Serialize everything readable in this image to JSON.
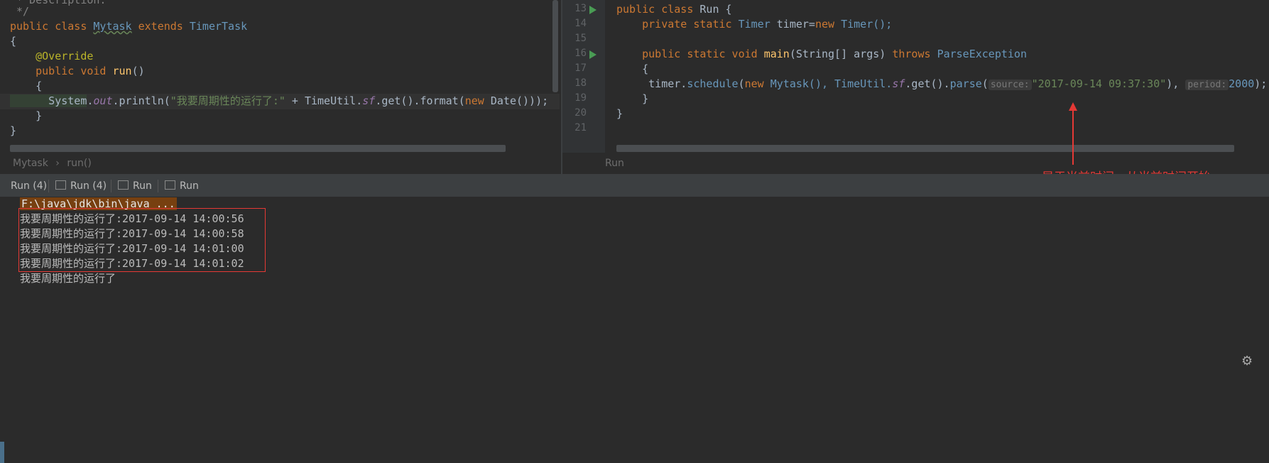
{
  "left_editor": {
    "lines": {
      "l0": " * Description:",
      "l1": " */",
      "l2_kw": "public class ",
      "l2_name": "Mytask",
      "l2_ext": " extends ",
      "l2_parent": "TimerTask",
      "l3": "{",
      "l4": "    @Override",
      "l5_kw": "    public void ",
      "l5_fn": "run",
      "l5_rest": "()",
      "l6": "    {",
      "l7_a": "      System",
      "l7_b": ".",
      "l7_out": "out",
      "l7_c": ".println(",
      "l7_str": "\"我要周期性的运行了:\"",
      "l7_d": " + TimeUtil.",
      "l7_sf": "sf",
      "l7_e": ".get().format(",
      "l7_new": "new ",
      "l7_f": "Date()));",
      "l8": "    }",
      "l9": "}"
    },
    "breadcrumb": {
      "class": "Mytask",
      "sep": "›",
      "method": "run()"
    }
  },
  "right_editor": {
    "line_numbers": [
      "13",
      "14",
      "15",
      "16",
      "17",
      "18",
      "19",
      "20",
      "21"
    ],
    "lines": {
      "r13_kw": "public class ",
      "r13_name": "Run {",
      "r14_kw": "    private static ",
      "r14_type": "Timer",
      "r14_rest": " timer=",
      "r14_new": "new ",
      "r14_end": "Timer();",
      "r16_kw": "    public static void ",
      "r16_fn": "main",
      "r16_a": "(String[] args) ",
      "r16_throws": "throws ",
      "r16_ex": "ParseException",
      "r17": "    {",
      "r18_a": "     timer.",
      "r18_fn": "schedule",
      "r18_b": "(",
      "r18_new": "new ",
      "r18_c": "Mytask(), TimeUtil.",
      "r18_sf": "sf",
      "r18_d": ".get().",
      "r18_parse": "parse",
      "r18_e": "(",
      "r18_hint1": "source:",
      "r18_str": "\"2017-09-14 09:37:30\"",
      "r18_f": "), ",
      "r18_hint2": "period:",
      "r18_num": "2000",
      "r18_g": ");",
      "r19": "    }",
      "r20": "}"
    },
    "breadcrumb": "Run"
  },
  "tool_tabs": [
    {
      "label": "Run (4)"
    },
    {
      "label": "Run (4)"
    },
    {
      "label": "Run"
    },
    {
      "label": "Run"
    }
  ],
  "console": {
    "command": "F:\\java\\jdk\\bin\\java ...",
    "output": [
      "我要周期性的运行了:2017-09-14 14:00:56",
      "我要周期性的运行了:2017-09-14 14:00:58",
      "我要周期性的运行了:2017-09-14 14:01:00",
      "我要周期性的运行了:2017-09-14 14:01:02"
    ],
    "partial_line": "我要周期性的运行了"
  },
  "annotation": {
    "text": "早于当前时间，从当前时间开始",
    "color": "#e53935"
  },
  "icons": {
    "gear": "gear-icon",
    "run_marker": "run-gutter-icon"
  }
}
